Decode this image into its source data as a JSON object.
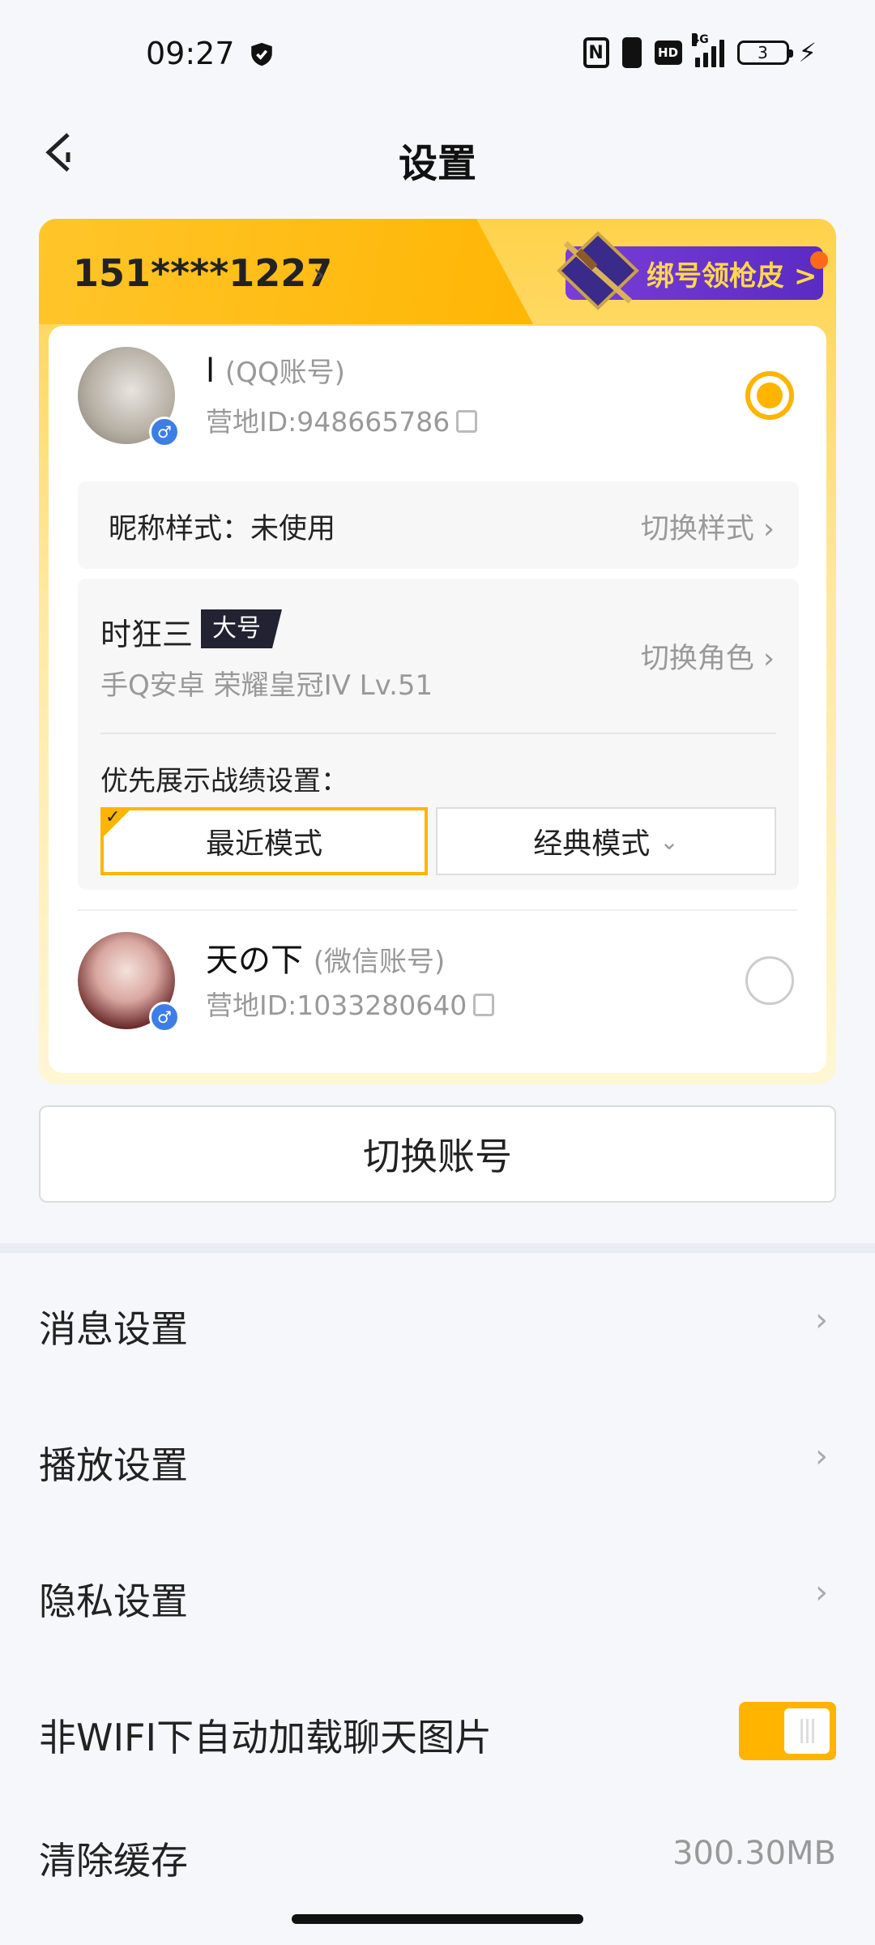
{
  "status_bar": {
    "time": "09:27",
    "signal_label": "4G",
    "battery_level": "3"
  },
  "header": {
    "title": "设置"
  },
  "account_card": {
    "phone": "151****1227",
    "bind_promo": "绑号领枪皮 >",
    "accounts": [
      {
        "name": "l",
        "type": "(QQ账号)",
        "camp_id": "营地ID:948665786",
        "selected": true
      },
      {
        "name": "天の下",
        "type": "(微信账号)",
        "camp_id": "营地ID:1033280640",
        "selected": false
      }
    ],
    "nickname_style": {
      "label": "昵称样式：未使用",
      "action": "切换样式"
    },
    "role": {
      "name": "时狂三",
      "tag": "大号",
      "desc": "手Q安卓  荣耀皇冠IV  Lv.51",
      "action": "切换角色",
      "pref_label": "优先展示战绩设置：",
      "mode_recent": "最近模式",
      "mode_classic": "经典模式"
    }
  },
  "switch_account_label": "切换账号",
  "settings": {
    "message": "消息设置",
    "playback": "播放设置",
    "privacy": "隐私设置",
    "auto_load": "非WIFI下自动加载聊天图片",
    "auto_load_on": true,
    "clear_cache": "清除缓存",
    "cache_size": "300.30MB"
  },
  "colors": {
    "accent": "#ffb400",
    "promo": "#5a2bc2",
    "background": "#f5f7fa"
  }
}
